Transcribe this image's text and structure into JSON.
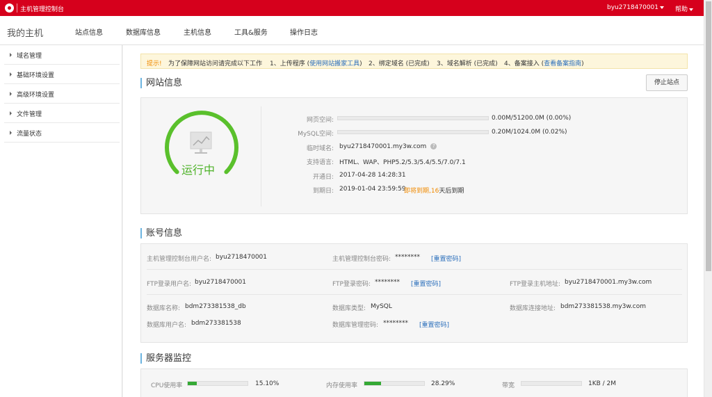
{
  "topbar": {
    "title": "主机管理控制台",
    "user": "byu2718470001",
    "help": "帮助"
  },
  "navbar": {
    "brand": "我的主机",
    "items": [
      "站点信息",
      "数据库信息",
      "主机信息",
      "工具&服务",
      "操作日志"
    ]
  },
  "sidebar": {
    "items": [
      "域名管理",
      "基础环境设置",
      "高级环境设置",
      "文件管理",
      "流量状态"
    ]
  },
  "notice": {
    "tip": "提示!",
    "intro": "为了保障网站访问请完成以下工作",
    "step1_pre": "1、上传程序 (",
    "step1_link": "使用网站搬家工具",
    "step1_post": ")",
    "step2": "2、绑定域名 (已完成)",
    "step3": "3、域名解析 (已完成)",
    "step4_pre": "4、备案接入 (",
    "step4_link": "查看备案指南",
    "step4_post": ")"
  },
  "site": {
    "title": "网站信息",
    "stop_button": "停止站点",
    "status": "运行中",
    "web_space_label": "网页空间:",
    "web_space_value": "0.00M/51200.0M (0.00%)",
    "web_space_fraction": 0.0,
    "mysql_label": "MySQL空间:",
    "mysql_value": "0.20M/1024.0M (0.02%)",
    "mysql_fraction": 0.0002,
    "temp_domain_label": "临时域名:",
    "temp_domain_value": "byu2718470001.my3w.com",
    "lang_label": "支持语言:",
    "lang_value": "HTML、WAP、PHP5.2/5.3/5.4/5.5/7.0/7.1",
    "open_label": "开通日:",
    "open_value": "2017-04-28 14:28:31",
    "expire_label": "到期日:",
    "expire_value": "2019-01-04 23:59:59",
    "expire_warn_pre": "即将到期,",
    "expire_days": "16",
    "expire_warn_post": "天后到期",
    "help_mark": "?"
  },
  "account": {
    "title": "账号信息",
    "ctrl_user_label": "主机管理控制台用户名:",
    "ctrl_user_value": "byu2718470001",
    "ctrl_pwd_label": "主机管理控制台密码:",
    "ctrl_pwd_value": "********",
    "reset": "[重置密码]",
    "ftp_user_label": "FTP登录用户名:",
    "ftp_user_value": "byu2718470001",
    "ftp_pwd_label": "FTP登录密码:",
    "ftp_pwd_value": "********",
    "ftp_host_label": "FTP登录主机地址:",
    "ftp_host_value": "byu2718470001.my3w.com",
    "db_name_label": "数据库名称:",
    "db_name_value": "bdm273381538_db",
    "db_type_label": "数据库类型:",
    "db_type_value": "MySQL",
    "db_host_label": "数据库连接地址:",
    "db_host_value": "bdm273381538.my3w.com",
    "db_user_label": "数据库用户名:",
    "db_user_value": "bdm273381538",
    "db_pwd_label": "数据库管理密码:",
    "db_pwd_value": "********"
  },
  "monitor": {
    "title": "服务器监控",
    "cpu_label": "CPU使用率",
    "cpu_value": "15.10%",
    "cpu_fraction": 0.151,
    "mem_label": "内存使用率",
    "mem_value": "28.29%",
    "mem_fraction": 0.2829,
    "bw_label": "带宽",
    "bw_value": "1KB / 2M",
    "bw_fraction": 0.0
  },
  "colors": {
    "brand_red": "#d6001c",
    "status_green": "#4fb32a",
    "link_blue": "#2a6ebb",
    "warn_orange": "#f08a00"
  }
}
